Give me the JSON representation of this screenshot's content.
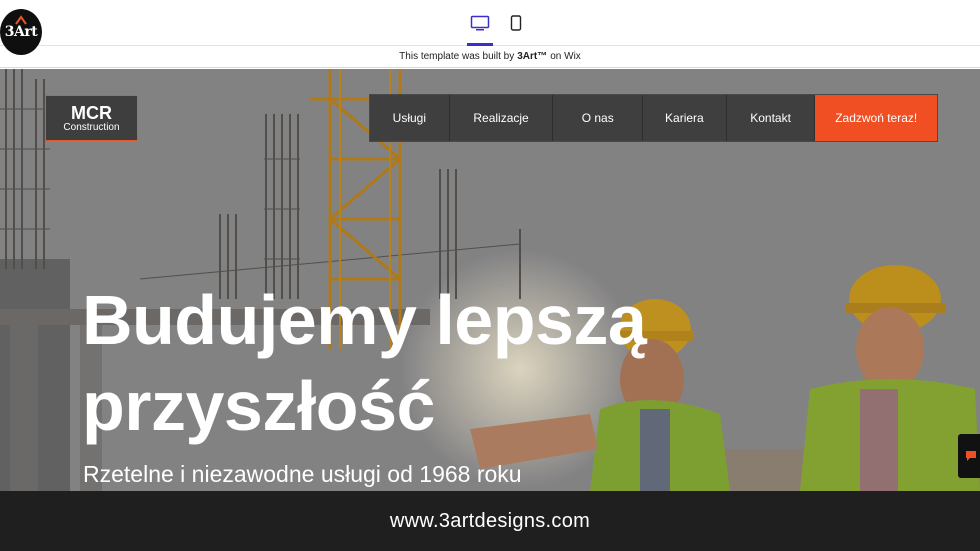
{
  "editor": {
    "logo_text": "3Art",
    "logo_trademark": "®",
    "devices": [
      "desktop-icon",
      "mobile-icon"
    ],
    "active_device": "desktop",
    "accent_color": "#3b2fc9"
  },
  "builtbar": {
    "prefix": "This template was built by",
    "brand": "3Art™",
    "suffix": "on Wix"
  },
  "site": {
    "logo_title": "MCR",
    "logo_subtitle": "Construction",
    "nav": [
      "Usługi",
      "Realizacje",
      "O nas",
      "Kariera",
      "Kontakt"
    ],
    "cta": "Zadzwoń teraz!",
    "cta_color": "#f04e23",
    "hero_title_line1": "Budujemy lepszą",
    "hero_title_line2": "przyszłość",
    "hero_subtitle": "Rzetelne i niezawodne usługi od 1968 roku"
  },
  "footer": {
    "url": "www.3artdesigns.com"
  }
}
